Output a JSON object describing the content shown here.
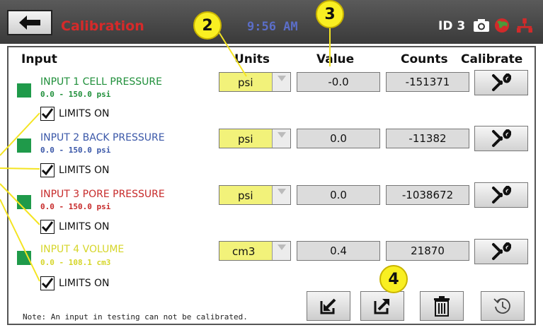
{
  "header": {
    "title": "Calibration",
    "time": "9:56 AM",
    "device_id": "ID 3"
  },
  "columns": {
    "input": "Input",
    "units": "Units",
    "value": "Value",
    "counts": "Counts",
    "calibrate": "Calibrate"
  },
  "inputs": [
    {
      "name": "INPUT 1 CELL PRESSURE",
      "range": "0.0 - 150.0 psi",
      "limits_label": "LIMITS ON",
      "limits_on": true,
      "unit": "psi",
      "value": "-0.0",
      "counts": "-151371",
      "color": "#1f8f3a"
    },
    {
      "name": "INPUT 2 BACK PRESSURE",
      "range": "0.0 - 150.0 psi",
      "limits_label": "LIMITS ON",
      "limits_on": true,
      "unit": "psi",
      "value": "0.0",
      "counts": "-11382",
      "color": "#3a57a8"
    },
    {
      "name": "INPUT 3 PORE PRESSURE",
      "range": "0.0 - 150.0 psi",
      "limits_label": "LIMITS ON",
      "limits_on": true,
      "unit": "psi",
      "value": "0.0",
      "counts": "-1038672",
      "color": "#c72a2a"
    },
    {
      "name": "INPUT 4 VOLUME",
      "range": "0.0 - 108.1 cm3",
      "limits_label": "LIMITS ON",
      "limits_on": true,
      "unit": "cm3",
      "value": "0.4",
      "counts": "21870",
      "color": "#d6d62a"
    }
  ],
  "note": "Note:  An input in testing can not be calibrated.",
  "callouts": [
    "2",
    "3",
    "4"
  ],
  "colors": {
    "header_bg": "#454545",
    "title_red": "#d62a2a",
    "time_blue": "#5b6ec8",
    "indicator_green": "#1f9a4a",
    "unit_yellow": "#f2f27a",
    "callout_yellow": "#f9ef22"
  },
  "icons": [
    "back-arrow-icon",
    "camera-icon",
    "globe-icon",
    "network-icon",
    "wrench-icon",
    "import-icon",
    "export-icon",
    "trash-icon",
    "restore-icon"
  ]
}
